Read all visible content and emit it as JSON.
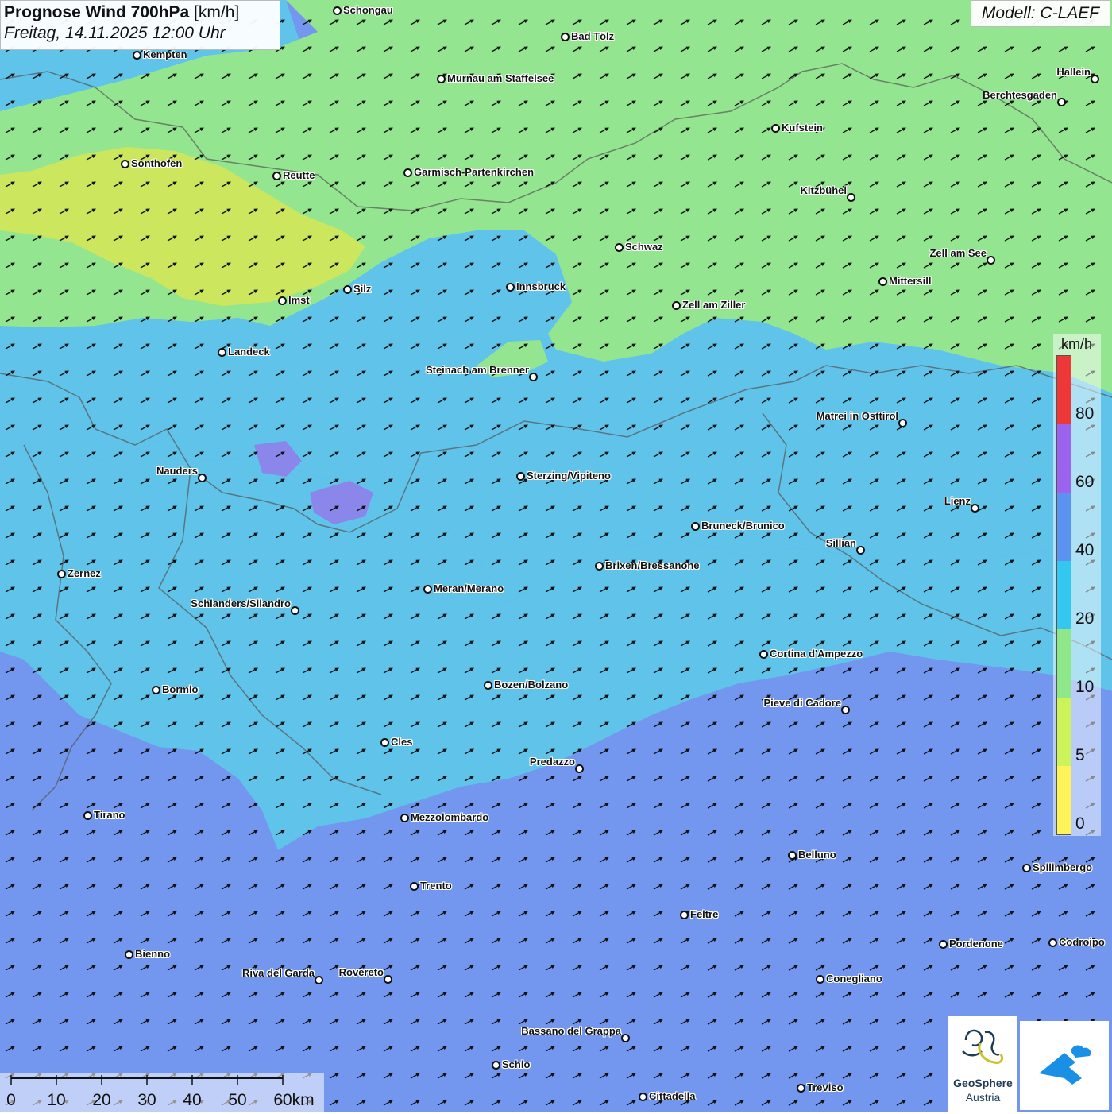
{
  "header": {
    "title_bold": "Prognose Wind 700hPa",
    "title_unit": " [km/h]",
    "datetime": "Freitag, 14.11.2025 12:00 Uhr"
  },
  "model_label": "Modell: C-LAEF",
  "legend": {
    "unit": "km/h",
    "levels": [
      "0",
      "5",
      "10",
      "20",
      "40",
      "60",
      "80"
    ],
    "colors": [
      "#fff35a",
      "#cdf35a",
      "#8ee88a",
      "#33c8f0",
      "#5b93f0",
      "#9b63ee",
      "#ee3838"
    ]
  },
  "region_colors": {
    "strong": "#7396ee",
    "medium": "#5fc3ea",
    "light": "#93e68f",
    "calm": "#cce65d",
    "purple_patch": "#8a86ea"
  },
  "wind_direction": "Südwest",
  "scalebar": {
    "labels": [
      "0",
      "10",
      "20",
      "30",
      "40",
      "50",
      "60km"
    ]
  },
  "logo": {
    "name": "GeoSphere",
    "sub": "Austria"
  },
  "cities": [
    {
      "name": "Schongau",
      "side": "r"
    },
    {
      "name": "Bad Tölz",
      "side": "r"
    },
    {
      "name": "Kempten",
      "side": "r"
    },
    {
      "name": "Murnau am Staffelsee",
      "side": "r"
    },
    {
      "name": "Hallein",
      "side": "l"
    },
    {
      "name": "Berchtesgaden",
      "side": "l"
    },
    {
      "name": "Kufstein",
      "side": "r"
    },
    {
      "name": "Sonthofen",
      "side": "r"
    },
    {
      "name": "Reutte",
      "side": "r"
    },
    {
      "name": "Garmisch-Partenkirchen",
      "side": "r"
    },
    {
      "name": "Kitzbühel",
      "side": "l"
    },
    {
      "name": "Schwaz",
      "side": "r"
    },
    {
      "name": "Zell am See",
      "side": "l"
    },
    {
      "name": "Mittersill",
      "side": "r"
    },
    {
      "name": "Innsbruck",
      "side": "r"
    },
    {
      "name": "Silz",
      "side": "r"
    },
    {
      "name": "Imst",
      "side": "r"
    },
    {
      "name": "Zell am Ziller",
      "side": "r"
    },
    {
      "name": "Landeck",
      "side": "r"
    },
    {
      "name": "Steinach am Brenner",
      "side": "l"
    },
    {
      "name": "Matrei in Osttirol",
      "side": "l"
    },
    {
      "name": "Nauders",
      "side": "l"
    },
    {
      "name": "Sterzing/Vipiteno",
      "side": "r"
    },
    {
      "name": "Lienz",
      "side": "l"
    },
    {
      "name": "Bruneck/Brunico",
      "side": "r"
    },
    {
      "name": "Sillian",
      "side": "l"
    },
    {
      "name": "Zernez",
      "side": "r"
    },
    {
      "name": "Brixen/Bressanone",
      "side": "r"
    },
    {
      "name": "Meran/Merano",
      "side": "r"
    },
    {
      "name": "Schlanders/Silandro",
      "side": "l"
    },
    {
      "name": "Cortina d'Ampezzo",
      "side": "r"
    },
    {
      "name": "Bozen/Bolzano",
      "side": "r"
    },
    {
      "name": "Bormio",
      "side": "r"
    },
    {
      "name": "Pieve di Cadore",
      "side": "l"
    },
    {
      "name": "Cles",
      "side": "r"
    },
    {
      "name": "Predazzo",
      "side": "l"
    },
    {
      "name": "Tirano",
      "side": "r"
    },
    {
      "name": "Mezzolombardo",
      "side": "r"
    },
    {
      "name": "Belluno",
      "side": "r"
    },
    {
      "name": "Spilimbergo",
      "side": "r"
    },
    {
      "name": "Trento",
      "side": "r"
    },
    {
      "name": "Feltre",
      "side": "r"
    },
    {
      "name": "Pordenone",
      "side": "r"
    },
    {
      "name": "Codroipo",
      "side": "r"
    },
    {
      "name": "Bienno",
      "side": "r"
    },
    {
      "name": "Riva del Garda",
      "side": "l"
    },
    {
      "name": "Rovereto",
      "side": "l"
    },
    {
      "name": "Conegliano",
      "side": "r"
    },
    {
      "name": "Bassano del Grappa",
      "side": "l"
    },
    {
      "name": "Schio",
      "side": "r"
    },
    {
      "name": "Treviso",
      "side": "r"
    },
    {
      "name": "Cittadella",
      "side": "r"
    }
  ]
}
